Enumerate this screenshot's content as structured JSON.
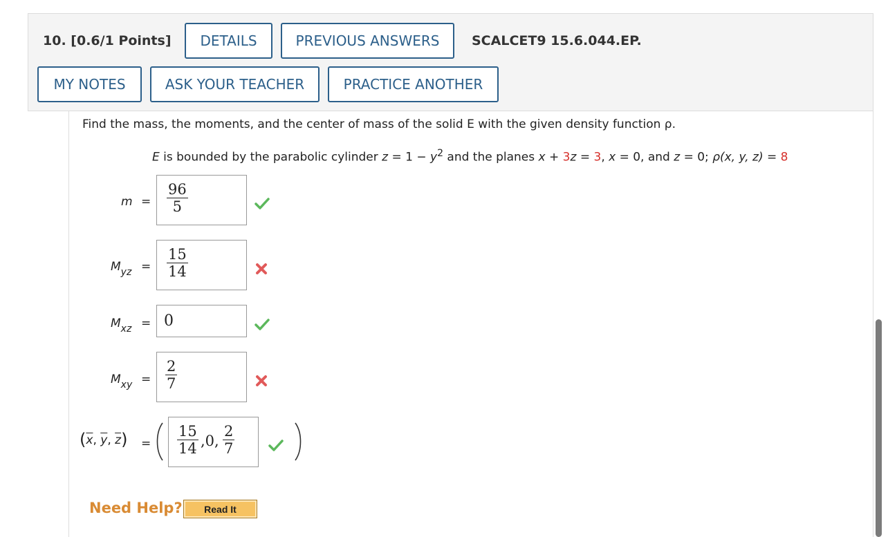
{
  "header": {
    "question_number": "10.",
    "points": "[0.6/1 Points]",
    "code": "SCALCET9 15.6.044.EP.",
    "buttons": {
      "details": "DETAILS",
      "previous_answers": "PREVIOUS ANSWERS",
      "my_notes": "MY NOTES",
      "ask_teacher": "ASK YOUR TEACHER",
      "practice_another": "PRACTICE ANOTHER"
    }
  },
  "problem": {
    "prompt": "Find the mass, the moments, and the center of mass of the solid E with the given density function ρ.",
    "given": {
      "E": "E",
      "p1": " is bounded by the parabolic cylinder ",
      "z1": "z",
      "p2": " = 1 − ",
      "y1": "y",
      "exp": "2",
      "p3": " and the planes ",
      "x1": "x",
      "p4": " + ",
      "c3a": "3",
      "z2": "z",
      "p5": " = ",
      "c3b": "3",
      "p6": ", ",
      "x2": "x",
      "p7": " = 0, and ",
      "z3": "z",
      "p8": " = 0; ",
      "rho": "ρ(x, y, z)",
      "p9": " = ",
      "c8": "8"
    }
  },
  "answers": {
    "m": {
      "label": "m",
      "sub": "",
      "num": "96",
      "den": "5",
      "status": "correct"
    },
    "myz": {
      "label": "M",
      "sub": "yz",
      "num": "15",
      "den": "14",
      "status": "incorrect"
    },
    "mxz": {
      "label": "M",
      "sub": "xz",
      "value": "0",
      "status": "correct"
    },
    "mxy": {
      "label": "M",
      "sub": "xy",
      "num": "2",
      "den": "7",
      "status": "incorrect"
    },
    "center": {
      "xbar": "x",
      "ybar": "y",
      "zbar": "z",
      "comma": ",",
      "a_num": "15",
      "a_den": "14",
      "mid": ",0,",
      "b_num": "2",
      "b_den": "7",
      "status": "correct"
    },
    "equals": "="
  },
  "help": {
    "need_help": "Need Help?",
    "read_it": "Read It"
  },
  "colors": {
    "button_blue": "#2c5f8a",
    "red": "#d6302b",
    "help_orange": "#d98b34",
    "correct_green": "#5cb85c",
    "incorrect_red": "#e15a5a"
  }
}
